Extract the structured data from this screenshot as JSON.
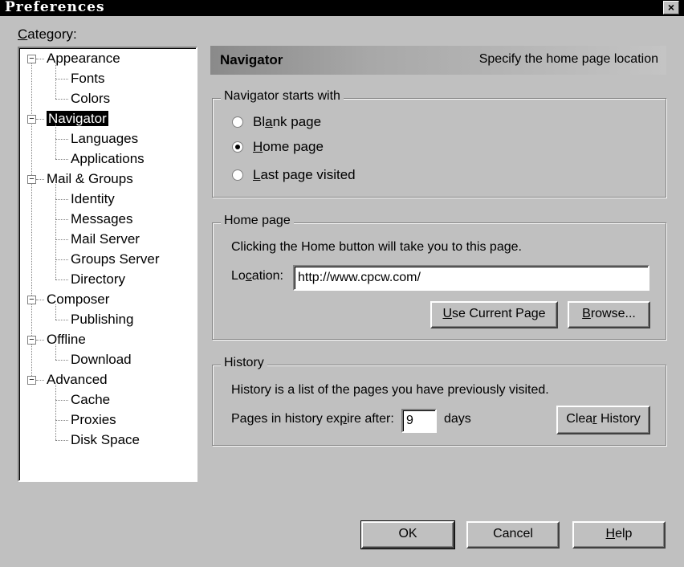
{
  "window": {
    "title": "Preferences",
    "close_glyph": "×"
  },
  "category": {
    "label_first": "C",
    "label_rest": "ategory:"
  },
  "tree": [
    {
      "label": "Appearance",
      "level": 0,
      "expander": "−"
    },
    {
      "label": "Fonts",
      "level": 1
    },
    {
      "label": "Colors",
      "level": 1
    },
    {
      "label": "Navigator",
      "level": 0,
      "expander": "−",
      "selected": true
    },
    {
      "label": "Languages",
      "level": 1
    },
    {
      "label": "Applications",
      "level": 1
    },
    {
      "label": "Mail & Groups",
      "level": 0,
      "expander": "−"
    },
    {
      "label": "Identity",
      "level": 1
    },
    {
      "label": "Messages",
      "level": 1
    },
    {
      "label": "Mail Server",
      "level": 1
    },
    {
      "label": "Groups Server",
      "level": 1
    },
    {
      "label": "Directory",
      "level": 1
    },
    {
      "label": "Composer",
      "level": 0,
      "expander": "−"
    },
    {
      "label": "Publishing",
      "level": 1
    },
    {
      "label": "Offline",
      "level": 0,
      "expander": "−"
    },
    {
      "label": "Download",
      "level": 1
    },
    {
      "label": "Advanced",
      "level": 0,
      "expander": "−"
    },
    {
      "label": "Cache",
      "level": 1
    },
    {
      "label": "Proxies",
      "level": 1
    },
    {
      "label": "Disk Space",
      "level": 1
    }
  ],
  "header": {
    "title": "Navigator",
    "subtitle": "Specify the home page location"
  },
  "starts_with": {
    "legend": "Navigator starts with",
    "options": [
      {
        "pre": "Bl",
        "mn": "a",
        "post": "nk page",
        "checked": false
      },
      {
        "pre": "",
        "mn": "H",
        "post": "ome page",
        "checked": true
      },
      {
        "pre": "",
        "mn": "L",
        "post": "ast page visited",
        "checked": false
      }
    ]
  },
  "home_page": {
    "legend": "Home page",
    "description": "Clicking the Home button will take you to this page.",
    "location_pre": "Lo",
    "location_mn": "c",
    "location_post": "ation:",
    "location_value": "http://www.cpcw.com/",
    "use_current_mn": "U",
    "use_current_rest": "se Current Page",
    "browse_pre": "",
    "browse_mn": "B",
    "browse_post": "rowse..."
  },
  "history": {
    "legend": "History",
    "description": "History is a list of the pages you have previously visited.",
    "expire_pre": "Pages in history ex",
    "expire_mn": "p",
    "expire_post": "ire after:",
    "expire_value": "9",
    "days_label": "days",
    "clear_pre": "Clea",
    "clear_mn": "r",
    "clear_post": " History"
  },
  "footer": {
    "ok": "OK",
    "cancel": "Cancel",
    "help_mn": "H",
    "help_rest": "elp"
  }
}
